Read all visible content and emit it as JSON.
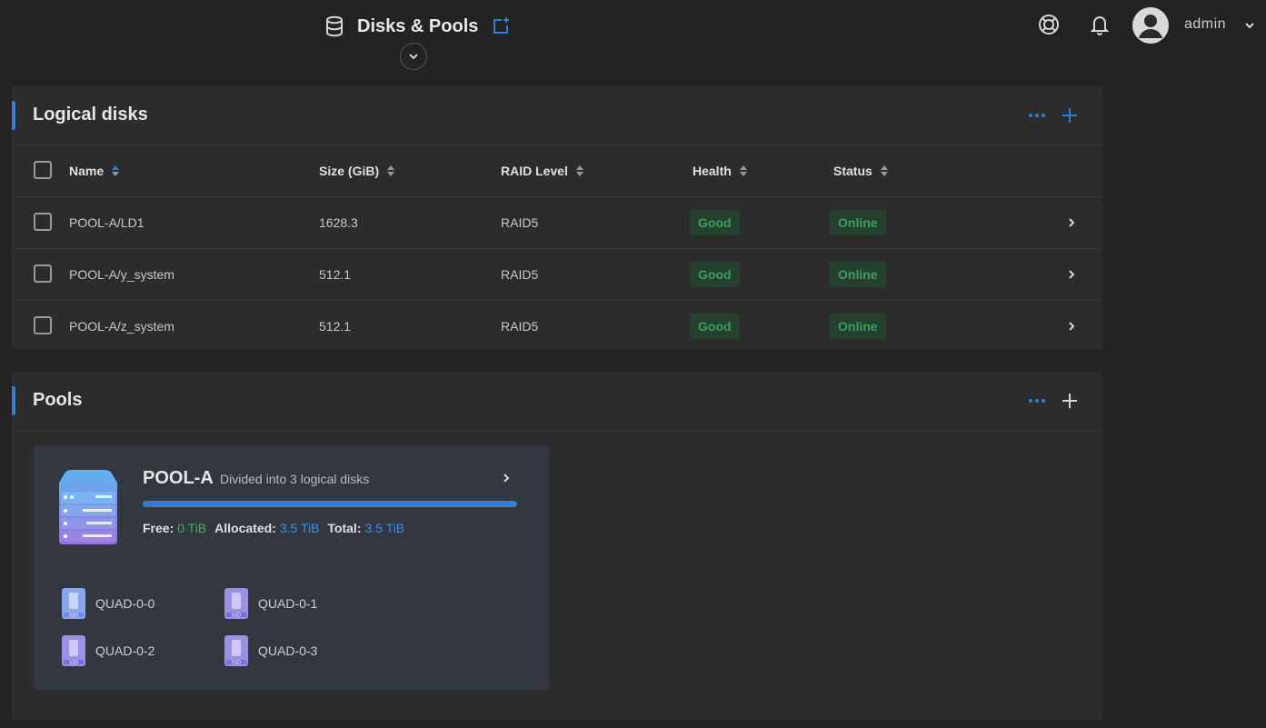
{
  "header": {
    "title": "Disks & Pools",
    "username": "admin"
  },
  "logical_disks": {
    "title": "Logical disks",
    "columns": {
      "name": "Name",
      "size": "Size (GiB)",
      "raid": "RAID Level",
      "health": "Health",
      "status": "Status"
    },
    "rows": [
      {
        "name": "POOL-A/LD1",
        "size": "1628.3",
        "raid": "RAID5",
        "health": "Good",
        "status": "Online"
      },
      {
        "name": "POOL-A/y_system",
        "size": "512.1",
        "raid": "RAID5",
        "health": "Good",
        "status": "Online"
      },
      {
        "name": "POOL-A/z_system",
        "size": "512.1",
        "raid": "RAID5",
        "health": "Good",
        "status": "Online"
      }
    ]
  },
  "pools": {
    "title": "Pools",
    "items": [
      {
        "name": "POOL-A",
        "description": "Divided into 3 logical disks",
        "allocated_fraction": 1.0,
        "free_label": "Free:",
        "free_value": "0 TiB",
        "allocated_label": "Allocated:",
        "allocated_value": "3.5 TiB",
        "total_label": "Total:",
        "total_value": "3.5 TiB",
        "drives": [
          "QUAD-0-0",
          "QUAD-0-1",
          "QUAD-0-2",
          "QUAD-0-3"
        ]
      }
    ]
  },
  "colors": {
    "accent": "#2f7fd8",
    "good": "#3f9c62",
    "free": "#3fae68",
    "allocated": "#3a8ee4"
  },
  "icons": {
    "header": "database-icon",
    "new_window": "open-new-icon",
    "help": "lifebuoy-icon",
    "notifications": "bell-icon",
    "more": "more-horizontal-icon",
    "add": "plus-icon"
  }
}
